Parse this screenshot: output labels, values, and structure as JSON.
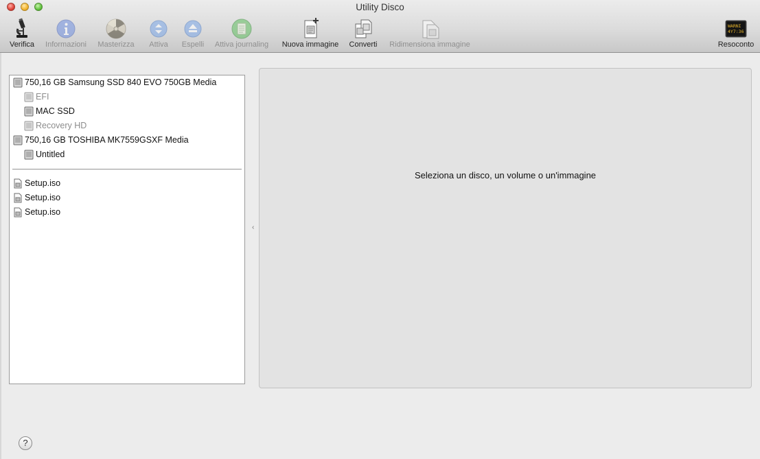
{
  "window": {
    "title": "Utility Disco"
  },
  "toolbar": {
    "items": [
      {
        "label": "Verifica",
        "icon": "microscope-icon",
        "enabled": true
      },
      {
        "label": "Informazioni",
        "icon": "info-icon",
        "enabled": false
      },
      {
        "label": "Masterizza",
        "icon": "burn-icon",
        "enabled": false
      },
      {
        "label": "Attiva",
        "icon": "mount-icon",
        "enabled": false
      },
      {
        "label": "Espelli",
        "icon": "eject-icon",
        "enabled": false
      },
      {
        "label": "Attiva journaling",
        "icon": "journaling-icon",
        "enabled": false
      },
      {
        "label": "Nuova immagine",
        "icon": "new-image-icon",
        "enabled": true
      },
      {
        "label": "Converti",
        "icon": "convert-icon",
        "enabled": true
      },
      {
        "label": "Ridimensiona immagine",
        "icon": "resize-image-icon",
        "enabled": false
      },
      {
        "label": "Resoconto",
        "icon": "console-log-icon",
        "enabled": true,
        "icon_text": "WARNI\n4Y7:36"
      }
    ]
  },
  "sidebar": {
    "disks": [
      {
        "label": "750,16 GB Samsung SSD 840 EVO 750GB Media",
        "level": 0,
        "dim": false
      },
      {
        "label": "EFI",
        "level": 1,
        "dim": true
      },
      {
        "label": "MAC SSD",
        "level": 1,
        "dim": false
      },
      {
        "label": "Recovery HD",
        "level": 1,
        "dim": true
      },
      {
        "label": "750,16 GB TOSHIBA MK7559GSXF Media",
        "level": 0,
        "dim": false
      },
      {
        "label": "Untitled",
        "level": 1,
        "dim": false
      }
    ],
    "images": [
      {
        "label": "Setup.iso"
      },
      {
        "label": "Setup.iso"
      },
      {
        "label": "Setup.iso"
      }
    ]
  },
  "detail": {
    "message": "Seleziona un disco, un volume o un'immagine"
  },
  "help": {
    "label": "?"
  },
  "colors": {
    "disabled_text": "#8f8f8f",
    "panel_bg": "#e3e3e3",
    "window_bg": "#ececec"
  }
}
